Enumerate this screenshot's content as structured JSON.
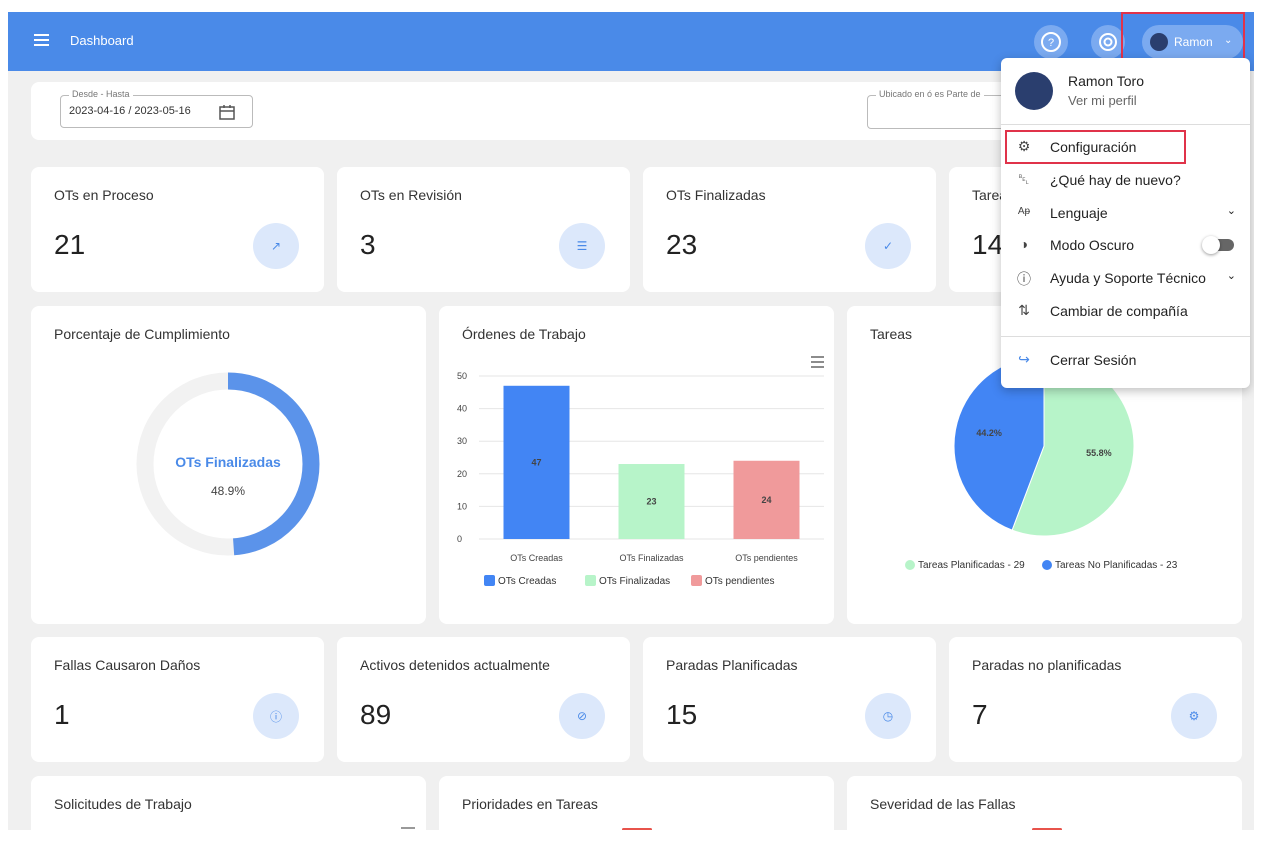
{
  "header": {
    "title": "Dashboard",
    "user_label": "Ramon"
  },
  "filters": {
    "range_legend": "Desde - Hasta",
    "range_value": "2023-04-16 / 2023-05-16",
    "location_legend": "Ubicado en ó es Parte de"
  },
  "kpi_row1": [
    {
      "title": "OTs en Proceso",
      "value": "21",
      "icon": "trending-up-icon"
    },
    {
      "title": "OTs en Revisión",
      "value": "3",
      "icon": "clipboard-icon"
    },
    {
      "title": "OTs Finalizadas",
      "value": "23",
      "icon": "check-circle-icon"
    },
    {
      "title": "Tareas",
      "value": "14",
      "icon": "task-icon"
    }
  ],
  "compliance": {
    "title": "Porcentaje de Cumplimiento",
    "center_label": "OTs Finalizadas",
    "percent": "48.9%",
    "fraction": 0.489
  },
  "work_orders_chart": {
    "title": "Órdenes de Trabajo",
    "chart_data": {
      "type": "bar",
      "categories": [
        "OTs Creadas",
        "OTs Finalizadas",
        "OTs pendientes"
      ],
      "values": [
        47,
        23,
        24
      ],
      "colors": [
        "#4285f4",
        "#b7f4c9",
        "#f09a9b"
      ],
      "yticks": [
        0,
        10,
        20,
        30,
        40,
        50
      ],
      "ylim": [
        0,
        50
      ],
      "legend": [
        "OTs Creadas",
        "OTs Finalizadas",
        "OTs pendientes"
      ],
      "legend_position": "bottom"
    }
  },
  "tasks_chart": {
    "title": "Tareas",
    "chart_data": {
      "type": "pie",
      "labels": [
        "Tareas Planificadas",
        "Tareas No Planificadas"
      ],
      "values": [
        29,
        23
      ],
      "percents": [
        "55.8%",
        "44.2%"
      ],
      "colors": [
        "#b7f4c9",
        "#4285f4"
      ],
      "legend": [
        "Tareas Planificadas - 29",
        "Tareas No Planificadas - 23"
      ],
      "legend_position": "bottom"
    }
  },
  "kpi_row2": [
    {
      "title": "Fallas Causaron Daños",
      "value": "1",
      "icon": "alert-circle-icon"
    },
    {
      "title": "Activos detenidos actualmente",
      "value": "89",
      "icon": "signal-off-icon"
    },
    {
      "title": "Paradas Planificadas",
      "value": "15",
      "icon": "calendar-clock-icon"
    },
    {
      "title": "Paradas no planificadas",
      "value": "7",
      "icon": "settings-icon"
    }
  ],
  "bottom_titles": [
    "Solicitudes de Trabajo",
    "Prioridades en Tareas",
    "Severidad de las Fallas"
  ],
  "user_menu": {
    "name": "Ramon Toro",
    "profile_link": "Ver mi perfil",
    "items": [
      {
        "label": "Configuración",
        "icon": "gear-icon"
      },
      {
        "label": "¿Qué hay de nuevo?",
        "icon": "bell-icon"
      },
      {
        "label": "Lenguaje",
        "icon": "translate-icon"
      },
      {
        "label": "Modo Oscuro",
        "icon": "contrast-icon"
      },
      {
        "label": "Ayuda y Soporte Técnico",
        "icon": "info-icon"
      },
      {
        "label": "Cambiar de compañía",
        "icon": "swap-icon"
      },
      {
        "label": "Cerrar Sesión",
        "icon": "logout-icon"
      }
    ]
  }
}
